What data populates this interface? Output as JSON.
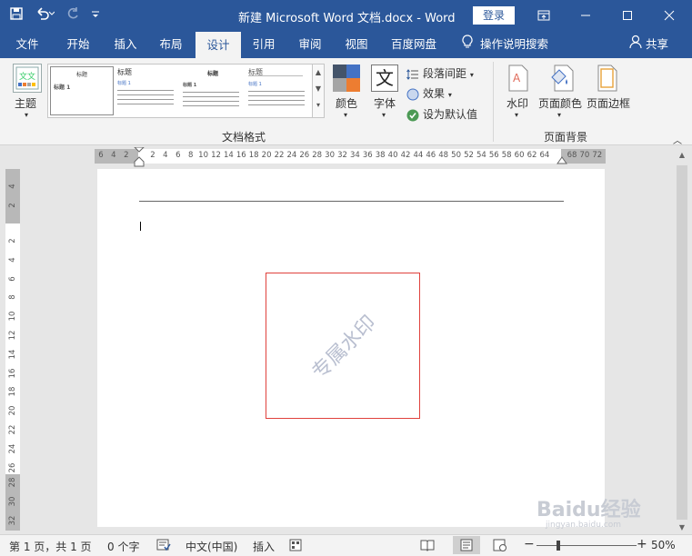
{
  "titlebar": {
    "save_icon": "save-icon",
    "undo_icon": "undo-icon",
    "redo_icon": "redo-icon",
    "customize_icon": "customize-qat-icon",
    "title": "新建 Microsoft Word 文档.docx  -  Word",
    "login_label": "登录",
    "ribbon_options_icon": "ribbon-display-icon",
    "minimize_icon": "minimize-icon",
    "maximize_icon": "maximize-icon",
    "close_icon": "close-icon",
    "bg_color": "#2b579a"
  },
  "menu": {
    "tabs": [
      "文件",
      "开始",
      "插入",
      "布局",
      "设计",
      "引用",
      "审阅",
      "视图",
      "百度网盘"
    ],
    "active_tab": "设计",
    "tell_me": "操作说明搜索",
    "share": "共享"
  },
  "ribbon": {
    "theme_label": "主题",
    "gallery_items": [
      {
        "title": "标题",
        "sub": "标题 1"
      },
      {
        "title": "标题",
        "sub": "标题 1"
      },
      {
        "title": "标题",
        "sub": "标题 1"
      },
      {
        "title": "标题",
        "sub": "标题 1"
      }
    ],
    "colors_label": "颜色",
    "font_glyph": "文",
    "fonts_label": "字体",
    "paragraph_spacing_label": "段落间距",
    "effects_label": "效果",
    "set_default_label": "设为默认值",
    "group_document_format": "文档格式",
    "watermark_label": "水印",
    "page_color_label": "页面颜色",
    "page_borders_label": "页面边框",
    "group_page_background": "页面背景",
    "accent_colors": [
      "#44546a",
      "#4472c4",
      "#ed7d31",
      "#a5a5a5"
    ]
  },
  "ruler": {
    "left_numbers": [
      "6",
      "4",
      "2"
    ],
    "numbers": [
      "2",
      "4",
      "6",
      "8",
      "10",
      "12",
      "14",
      "16",
      "18",
      "20",
      "22",
      "24",
      "26",
      "28",
      "30",
      "32",
      "34",
      "36",
      "38",
      "40",
      "42",
      "44",
      "46",
      "48",
      "50",
      "52",
      "54",
      "56",
      "58",
      "60",
      "62",
      "64"
    ],
    "right_numbers": [
      "68",
      "70",
      "72"
    ],
    "vertical_top_numbers": [
      "4",
      "2"
    ],
    "vertical_numbers": [
      "2",
      "4",
      "6",
      "8",
      "10",
      "12",
      "14",
      "16",
      "18",
      "20",
      "22",
      "24",
      "26"
    ],
    "vertical_bottom_numbers": [
      "28",
      "30",
      "32"
    ]
  },
  "document": {
    "watermark_text": "专属水印",
    "watermark_color": "#b9bfd0",
    "box_border_color": "#e0413c"
  },
  "statusbar": {
    "page_info": "第 1 页，共 1 页",
    "word_count": "0 个字",
    "language": "中文(中国)",
    "insert_mode": "插入",
    "zoom_percent": "50%",
    "zoom_minus": "−",
    "zoom_plus": "+"
  },
  "branding": {
    "baidu_logo_text": "Baidu经验",
    "baidu_url": "jingyan.baidu.com"
  }
}
